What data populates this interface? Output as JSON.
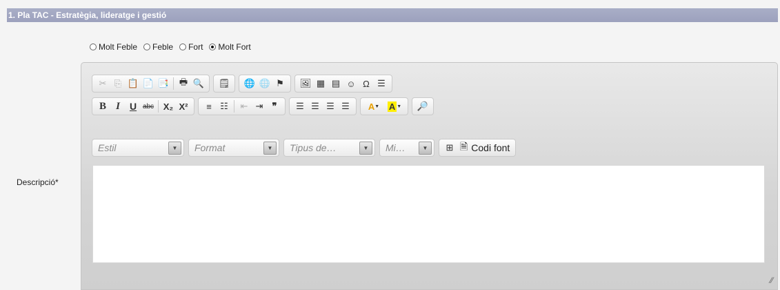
{
  "section": {
    "title": "1. Pla TAC - Estratègia, lideratge i gestió"
  },
  "rating": {
    "options": [
      "Molt Feble",
      "Feble",
      "Fort",
      "Molt Fort"
    ],
    "selected": "Molt Fort"
  },
  "description": {
    "label": "Descripció*",
    "value": ""
  },
  "toolbar": {
    "combos": {
      "style": "Estil",
      "format": "Format",
      "font": "Tipus de…",
      "size": "Mi…"
    },
    "source_label": "Codi font",
    "bold": "B",
    "italic": "I",
    "underline": "U",
    "strike": "abc",
    "subscript": "X₂",
    "superscript": "X²",
    "blockquote": "❞",
    "text_color": "A",
    "bg_color": "A"
  }
}
